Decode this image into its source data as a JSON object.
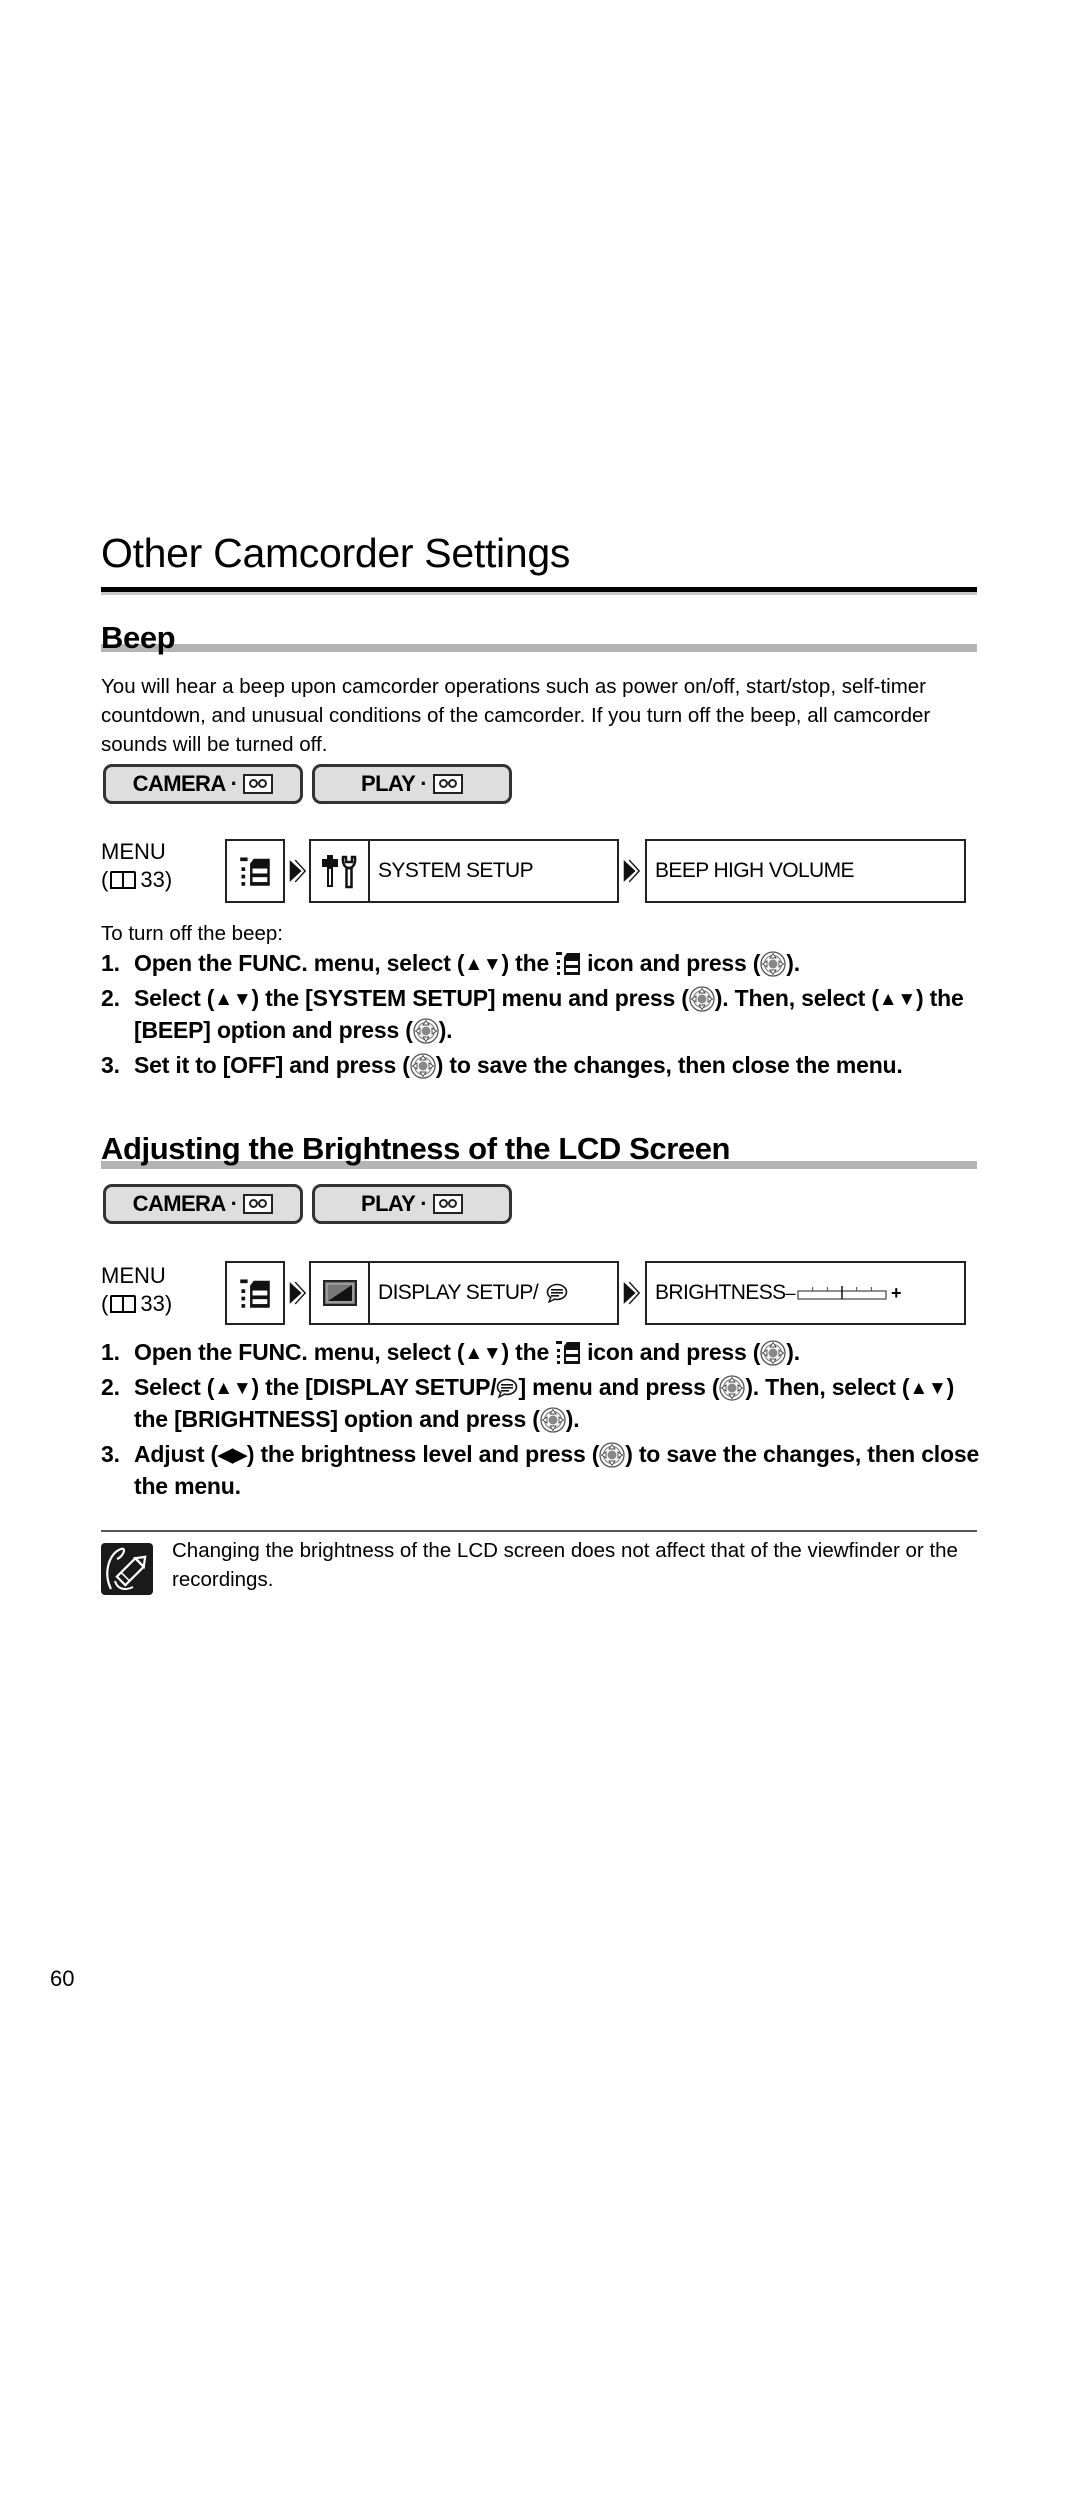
{
  "page": {
    "title": "Other Camcorder Settings",
    "page_number": "60"
  },
  "beep": {
    "heading": "Beep",
    "intro": "You will hear a beep upon camcorder operations such as power on/off, start/stop, self-timer countdown, and unusual conditions of the camcorder. If you turn off the beep, all camcorder sounds will be turned off.",
    "modes": [
      {
        "label": "CAMERA",
        "icon": "tape-icon"
      },
      {
        "label": "PLAY",
        "icon": "tape-icon"
      }
    ],
    "menu_label": "MENU",
    "menu_ref": "33",
    "menu_path": {
      "root_icon": "func-menu-icon",
      "submenu_icon": "tools-icon",
      "submenu_label": "SYSTEM SETUP",
      "option_label": "BEEP HIGH VOLUME"
    },
    "steps_intro": "To turn off the beep:",
    "steps": [
      {
        "num": "1.",
        "parts": [
          "Open the FUNC. menu, select (",
          ") the",
          "icon and press (",
          ")."
        ]
      },
      {
        "num": "2.",
        "parts": [
          "Select (",
          ") the [SYSTEM SETUP] menu and press (",
          "). Then, select (",
          ") the [BEEP] option and press (",
          ")."
        ]
      },
      {
        "num": "3.",
        "parts": [
          "Set it to [OFF] and press (",
          ") to save the changes, then close the menu."
        ]
      }
    ]
  },
  "brightness": {
    "heading": "Adjusting the Brightness of the LCD Screen",
    "modes": [
      {
        "label": "CAMERA",
        "icon": "tape-icon"
      },
      {
        "label": "PLAY",
        "icon": "tape-icon"
      }
    ],
    "menu_label": "MENU",
    "menu_ref": "33",
    "menu_path": {
      "root_icon": "func-menu-icon",
      "submenu_icon": "display-icon",
      "submenu_label": "DISPLAY SETUP/",
      "submenu_suffix_icon": "speech-bubble-icon",
      "option_label": "BRIGHTNESS",
      "slider_minus": "–",
      "slider_plus": "+",
      "slider_level": 0.5
    },
    "steps": [
      {
        "num": "1.",
        "parts": [
          "Open the FUNC. menu, select (",
          ") the",
          "icon and press (",
          ")."
        ]
      },
      {
        "num": "2.",
        "parts": [
          "Select (",
          ") the [DISPLAY SETUP/",
          "] menu and press (",
          "). Then, select (",
          ") the [BRIGHTNESS] option and press (",
          ")."
        ]
      },
      {
        "num": "3.",
        "parts": [
          "Adjust (",
          ") the brightness level and press (",
          ") to save the changes, then close the menu."
        ]
      }
    ],
    "note": "Changing the brightness of the LCD screen does not affect that of the viewfinder or the recordings."
  },
  "glyphs": {
    "up_down": "▲▼",
    "left_right": "◀▶",
    "next_arrow": "▶"
  }
}
